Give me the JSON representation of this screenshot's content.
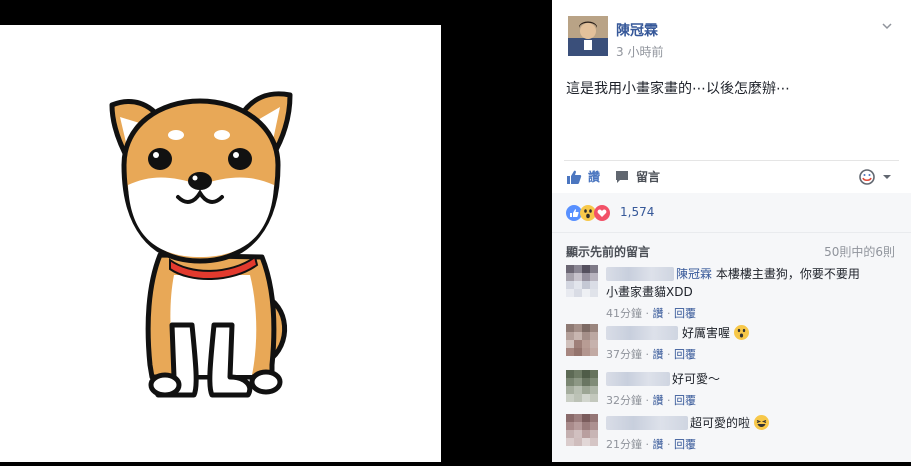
{
  "post": {
    "author": "陳冠霖",
    "time": "3 小時前",
    "text": "這是我用小畫家畫的⋯以後怎麼辦⋯"
  },
  "actions": {
    "like": "讚",
    "comment": "留言"
  },
  "reactions": {
    "count": "1,574"
  },
  "comments_section": {
    "show_previous": "顯示先前的留言",
    "count_label": "50則中的6則",
    "items": [
      {
        "author": "陳冠霖",
        "text_line1": "本樓樓主畫狗，你要不要用",
        "text_line2": "小畫家畫貓XDD",
        "time": "41分鐘",
        "like": "讚",
        "reply": "回覆"
      },
      {
        "author": "",
        "text": "好厲害喔",
        "time": "37分鐘",
        "like": "讚",
        "reply": "回覆"
      },
      {
        "author": "",
        "text": "好可愛～",
        "time": "32分鐘",
        "like": "讚",
        "reply": "回覆"
      },
      {
        "author": "",
        "text": "超可愛的啦",
        "time": "21分鐘",
        "like": "讚",
        "reply": "回覆"
      }
    ]
  },
  "colors": {
    "link": "#365899",
    "dog_orange": "#e8a857",
    "collar": "#e23a2e"
  }
}
